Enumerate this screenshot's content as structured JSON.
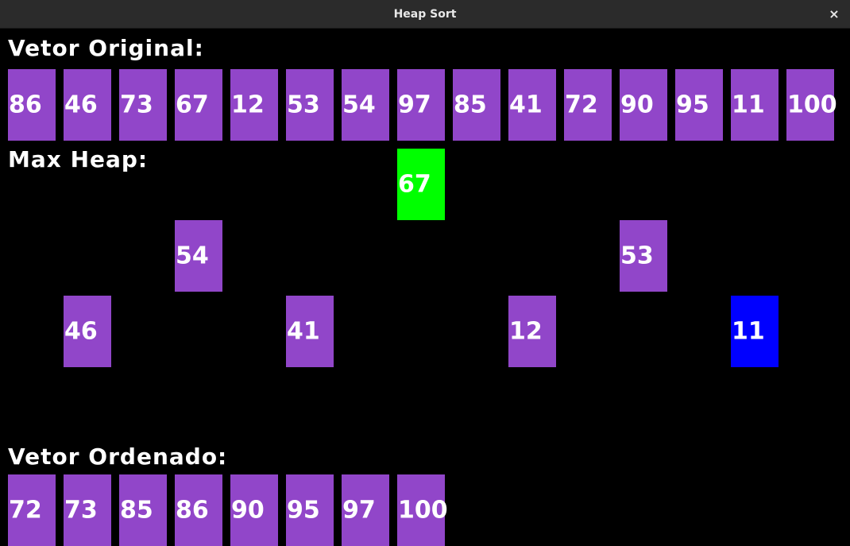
{
  "window": {
    "title": "Heap Sort",
    "close_glyph": "×"
  },
  "original": {
    "label": "Vetor Original:",
    "values": [
      "86",
      "46",
      "73",
      "67",
      "12",
      "53",
      "54",
      "97",
      "85",
      "41",
      "72",
      "90",
      "95",
      "11",
      "100"
    ]
  },
  "heap": {
    "label": "Max Heap:",
    "nodes": [
      "67",
      "54",
      "53",
      "46",
      "41",
      "12",
      "11"
    ],
    "root_color": "#00ff00",
    "last_color": "#0000ff"
  },
  "sorted": {
    "label": "Vetor Ordenado:",
    "values": [
      "72",
      "73",
      "85",
      "86",
      "90",
      "95",
      "97",
      "100"
    ]
  },
  "colors": {
    "box": "#9146c9",
    "background": "#000000",
    "text": "#ffffff"
  }
}
